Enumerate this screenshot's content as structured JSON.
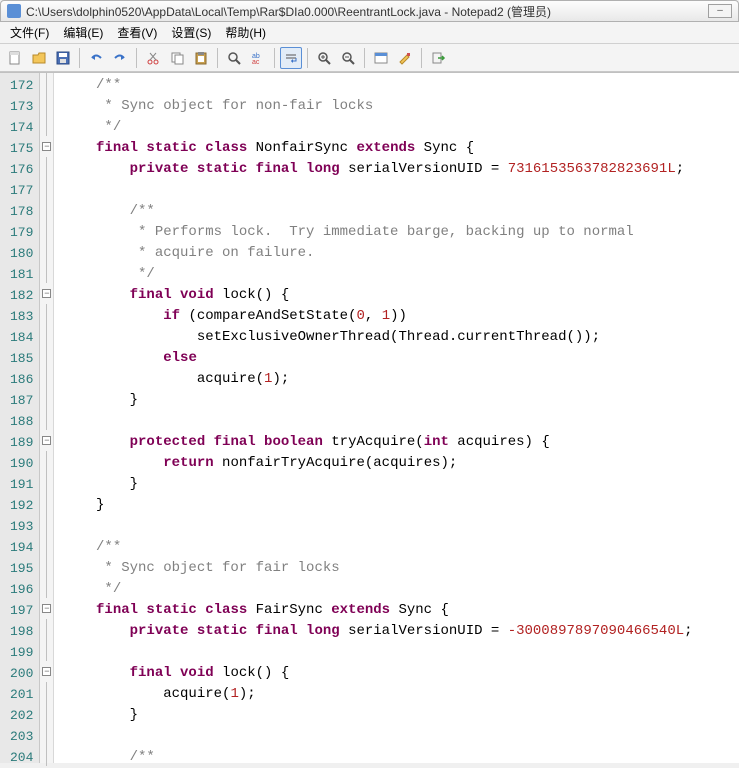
{
  "title": "C:\\Users\\dolphin0520\\AppData\\Local\\Temp\\Rar$DIa0.000\\ReentrantLock.java - Notepad2 (管理员)",
  "menu": {
    "file": "文件(F)",
    "edit": "编辑(E)",
    "view": "查看(V)",
    "settings": "设置(S)",
    "help": "帮助(H)"
  },
  "lines": [
    {
      "n": "172",
      "fold": "pipe",
      "tokens": [
        {
          "t": "    ",
          "c": ""
        },
        {
          "t": "/**",
          "c": "cm"
        }
      ]
    },
    {
      "n": "173",
      "fold": "pipe",
      "tokens": [
        {
          "t": "     * Sync object for non-fair locks",
          "c": "cm"
        }
      ]
    },
    {
      "n": "174",
      "fold": "pipe",
      "tokens": [
        {
          "t": "     */",
          "c": "cm"
        }
      ]
    },
    {
      "n": "175",
      "fold": "box",
      "tokens": [
        {
          "t": "    ",
          "c": ""
        },
        {
          "t": "final static class",
          "c": "kw"
        },
        {
          "t": " NonfairSync ",
          "c": "id"
        },
        {
          "t": "extends",
          "c": "kw"
        },
        {
          "t": " Sync {",
          "c": "id"
        }
      ]
    },
    {
      "n": "176",
      "fold": "pipe",
      "tokens": [
        {
          "t": "        ",
          "c": ""
        },
        {
          "t": "private static final long",
          "c": "kw"
        },
        {
          "t": " serialVersionUID = ",
          "c": "id"
        },
        {
          "t": "7316153563782823691L",
          "c": "num"
        },
        {
          "t": ";",
          "c": "id"
        }
      ]
    },
    {
      "n": "177",
      "fold": "pipe",
      "tokens": [
        {
          "t": "",
          "c": ""
        }
      ]
    },
    {
      "n": "178",
      "fold": "pipe",
      "tokens": [
        {
          "t": "        ",
          "c": ""
        },
        {
          "t": "/**",
          "c": "cm"
        }
      ]
    },
    {
      "n": "179",
      "fold": "pipe",
      "tokens": [
        {
          "t": "         * Performs lock.  Try immediate barge, backing up to normal",
          "c": "cm"
        }
      ]
    },
    {
      "n": "180",
      "fold": "pipe",
      "tokens": [
        {
          "t": "         * acquire on failure.",
          "c": "cm"
        }
      ]
    },
    {
      "n": "181",
      "fold": "pipe",
      "tokens": [
        {
          "t": "         */",
          "c": "cm"
        }
      ]
    },
    {
      "n": "182",
      "fold": "box",
      "tokens": [
        {
          "t": "        ",
          "c": ""
        },
        {
          "t": "final void",
          "c": "kw"
        },
        {
          "t": " lock() {",
          "c": "id"
        }
      ]
    },
    {
      "n": "183",
      "fold": "pipe",
      "tokens": [
        {
          "t": "            ",
          "c": ""
        },
        {
          "t": "if",
          "c": "kw"
        },
        {
          "t": " (compareAndSetState(",
          "c": "id"
        },
        {
          "t": "0",
          "c": "num"
        },
        {
          "t": ", ",
          "c": "id"
        },
        {
          "t": "1",
          "c": "num"
        },
        {
          "t": "))",
          "c": "id"
        }
      ]
    },
    {
      "n": "184",
      "fold": "pipe",
      "tokens": [
        {
          "t": "                setExclusiveOwnerThread(Thread.currentThread());",
          "c": "id"
        }
      ]
    },
    {
      "n": "185",
      "fold": "pipe",
      "tokens": [
        {
          "t": "            ",
          "c": ""
        },
        {
          "t": "else",
          "c": "kw"
        }
      ]
    },
    {
      "n": "186",
      "fold": "pipe",
      "tokens": [
        {
          "t": "                acquire(",
          "c": "id"
        },
        {
          "t": "1",
          "c": "num"
        },
        {
          "t": ");",
          "c": "id"
        }
      ]
    },
    {
      "n": "187",
      "fold": "pipe",
      "tokens": [
        {
          "t": "        }",
          "c": "id"
        }
      ]
    },
    {
      "n": "188",
      "fold": "pipe",
      "tokens": [
        {
          "t": "",
          "c": ""
        }
      ]
    },
    {
      "n": "189",
      "fold": "box",
      "tokens": [
        {
          "t": "        ",
          "c": ""
        },
        {
          "t": "protected final boolean",
          "c": "kw"
        },
        {
          "t": " tryAcquire(",
          "c": "id"
        },
        {
          "t": "int",
          "c": "kw"
        },
        {
          "t": " acquires) {",
          "c": "id"
        }
      ]
    },
    {
      "n": "190",
      "fold": "pipe",
      "tokens": [
        {
          "t": "            ",
          "c": ""
        },
        {
          "t": "return",
          "c": "kw"
        },
        {
          "t": " nonfairTryAcquire(acquires);",
          "c": "id"
        }
      ]
    },
    {
      "n": "191",
      "fold": "pipe",
      "tokens": [
        {
          "t": "        }",
          "c": "id"
        }
      ]
    },
    {
      "n": "192",
      "fold": "pipe",
      "tokens": [
        {
          "t": "    }",
          "c": "id"
        }
      ]
    },
    {
      "n": "193",
      "fold": "pipe",
      "tokens": [
        {
          "t": "",
          "c": ""
        }
      ]
    },
    {
      "n": "194",
      "fold": "pipe",
      "tokens": [
        {
          "t": "    ",
          "c": ""
        },
        {
          "t": "/**",
          "c": "cm"
        }
      ]
    },
    {
      "n": "195",
      "fold": "pipe",
      "tokens": [
        {
          "t": "     * Sync object for fair locks",
          "c": "cm"
        }
      ]
    },
    {
      "n": "196",
      "fold": "pipe",
      "tokens": [
        {
          "t": "     */",
          "c": "cm"
        }
      ]
    },
    {
      "n": "197",
      "fold": "box",
      "tokens": [
        {
          "t": "    ",
          "c": ""
        },
        {
          "t": "final static class",
          "c": "kw"
        },
        {
          "t": " FairSync ",
          "c": "id"
        },
        {
          "t": "extends",
          "c": "kw"
        },
        {
          "t": " Sync {",
          "c": "id"
        }
      ]
    },
    {
      "n": "198",
      "fold": "pipe",
      "tokens": [
        {
          "t": "        ",
          "c": ""
        },
        {
          "t": "private static final long",
          "c": "kw"
        },
        {
          "t": " serialVersionUID = ",
          "c": "id"
        },
        {
          "t": "-3000897897090466540L",
          "c": "num"
        },
        {
          "t": ";",
          "c": "id"
        }
      ]
    },
    {
      "n": "199",
      "fold": "pipe",
      "tokens": [
        {
          "t": "",
          "c": ""
        }
      ]
    },
    {
      "n": "200",
      "fold": "box",
      "tokens": [
        {
          "t": "        ",
          "c": ""
        },
        {
          "t": "final void",
          "c": "kw"
        },
        {
          "t": " lock() {",
          "c": "id"
        }
      ]
    },
    {
      "n": "201",
      "fold": "pipe",
      "tokens": [
        {
          "t": "            acquire(",
          "c": "id"
        },
        {
          "t": "1",
          "c": "num"
        },
        {
          "t": ");",
          "c": "id"
        }
      ]
    },
    {
      "n": "202",
      "fold": "pipe",
      "tokens": [
        {
          "t": "        }",
          "c": "id"
        }
      ]
    },
    {
      "n": "203",
      "fold": "pipe",
      "tokens": [
        {
          "t": "",
          "c": ""
        }
      ]
    },
    {
      "n": "204",
      "fold": "pipe",
      "tokens": [
        {
          "t": "        ",
          "c": ""
        },
        {
          "t": "/**",
          "c": "cm"
        }
      ]
    }
  ],
  "icons": {
    "new": "new-file-icon",
    "open": "open-folder-icon",
    "save": "save-icon",
    "undo": "undo-icon",
    "redo": "redo-icon",
    "cut": "cut-icon",
    "copy": "copy-icon",
    "paste": "paste-icon",
    "find": "find-icon",
    "replace": "replace-icon",
    "wrap": "word-wrap-icon",
    "zoomin": "zoom-in-icon",
    "zoomout": "zoom-out-icon",
    "scheme": "scheme-icon",
    "custom": "customize-icon",
    "close": "close-icon"
  }
}
